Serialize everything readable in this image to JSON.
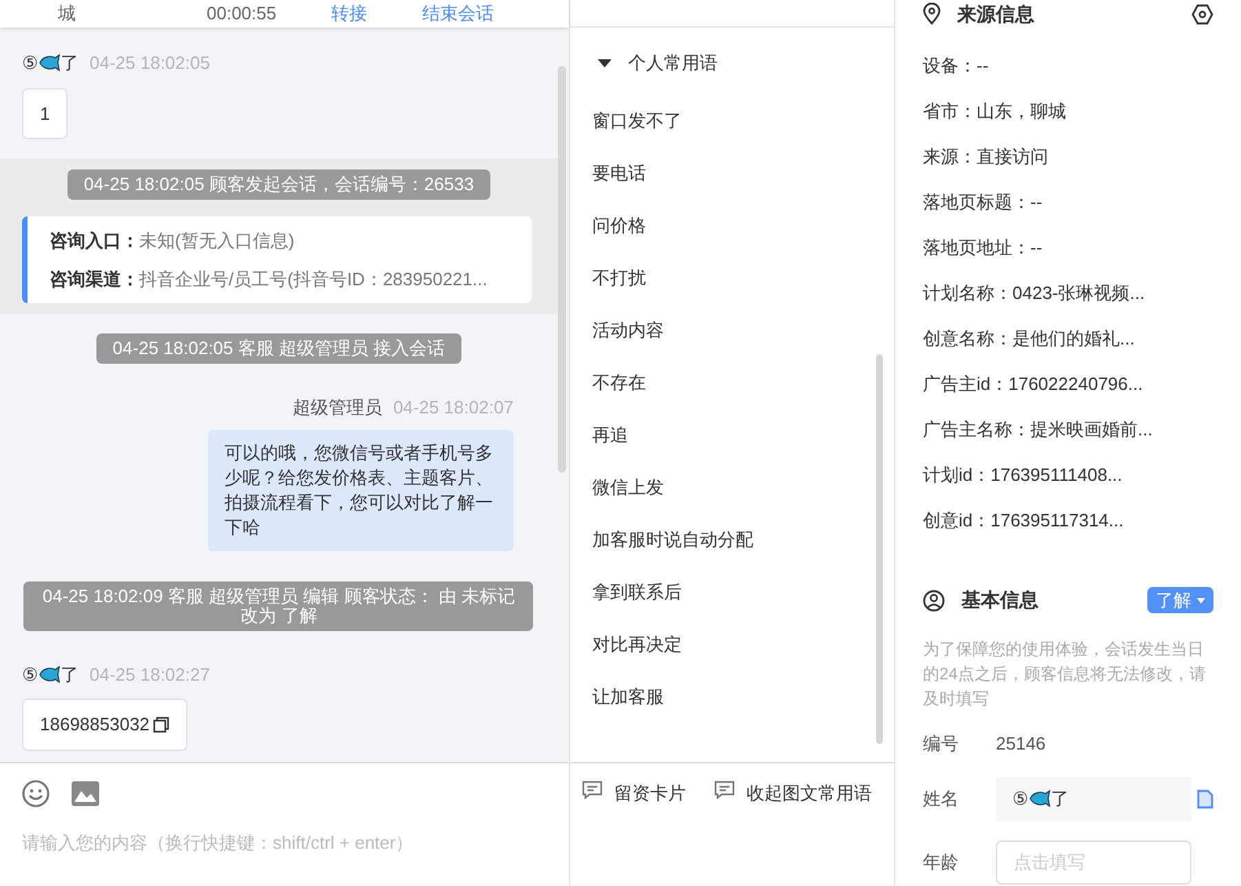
{
  "header": {
    "items": [
      {
        "kind": "text",
        "text": "城"
      },
      {
        "kind": "time",
        "text": "00:00:55"
      },
      {
        "kind": "link",
        "text": "转接"
      },
      {
        "kind": "link",
        "text": "结束会话"
      }
    ]
  },
  "messages": [
    {
      "kind": "customer",
      "name_prefix": "⑤",
      "name_suffix": "了",
      "time": "04-25 18:02:05",
      "text": "1",
      "copy": false
    },
    {
      "kind": "session_start",
      "text": "04-25 18:02:05 顾客发起会话，会话编号：26533",
      "rows": [
        {
          "label": "咨询入口：",
          "value": "未知(暂无入口信息)"
        },
        {
          "label": "咨询渠道：",
          "value": "抖音企业号/员工号(抖音号ID：283950221..."
        }
      ]
    },
    {
      "kind": "system",
      "text": "04-25 18:02:05 客服 超级管理员 接入会话"
    },
    {
      "kind": "agent",
      "name": "超级管理员",
      "time": "04-25 18:02:07",
      "text": "可以的哦，您微信号或者手机号多少呢？给您发价格表、主题客片、拍摄流程看下，您可以对比了解一下哈"
    },
    {
      "kind": "system",
      "text": "04-25 18:02:09 客服 超级管理员 编辑 顾客状态： 由 未标记改为 了解"
    },
    {
      "kind": "customer",
      "name_prefix": "⑤",
      "name_suffix": "了",
      "time": "04-25 18:02:27",
      "text": "18698853032",
      "copy": true
    },
    {
      "kind": "cut"
    }
  ],
  "input": {
    "placeholder": "请输入您的内容（换行快捷键：shift/ctrl + enter）"
  },
  "phrases": {
    "group": {
      "label": "个人常用语",
      "expanded": true
    },
    "items": [
      "窗口发不了",
      "要电话",
      "问价格",
      "不打扰",
      "活动内容",
      "不存在",
      "再追",
      "微信上发",
      "加客服时说自动分配",
      "拿到联系后",
      "对比再决定",
      "让加客服"
    ],
    "actions": [
      "留资卡片",
      "收起图文常用语"
    ]
  },
  "source": {
    "title": "来源信息",
    "rows": [
      "设备：--",
      "省市：山东，聊城",
      "来源：直接访问",
      "落地页标题：--",
      "落地页地址：--",
      "计划名称：0423-张琳视频...",
      "创意名称：是他们的婚礼...",
      "广告主id：176022240796...",
      "广告主名称：提米映画婚前...",
      "计划id：176395111408...",
      "创意id：176395117314..."
    ]
  },
  "basic": {
    "title": "基本信息",
    "status": "了解",
    "notice": "为了保障您的使用体验，会话发生当日的24点之后，顾客信息将无法修改，请及时填写",
    "fields": [
      {
        "kind": "text",
        "label": "编号",
        "value": "25146"
      },
      {
        "kind": "name",
        "label": "姓名",
        "prefix": "⑤",
        "suffix": "了"
      },
      {
        "kind": "input",
        "label": "年龄",
        "placeholder": "点击填写"
      }
    ]
  }
}
